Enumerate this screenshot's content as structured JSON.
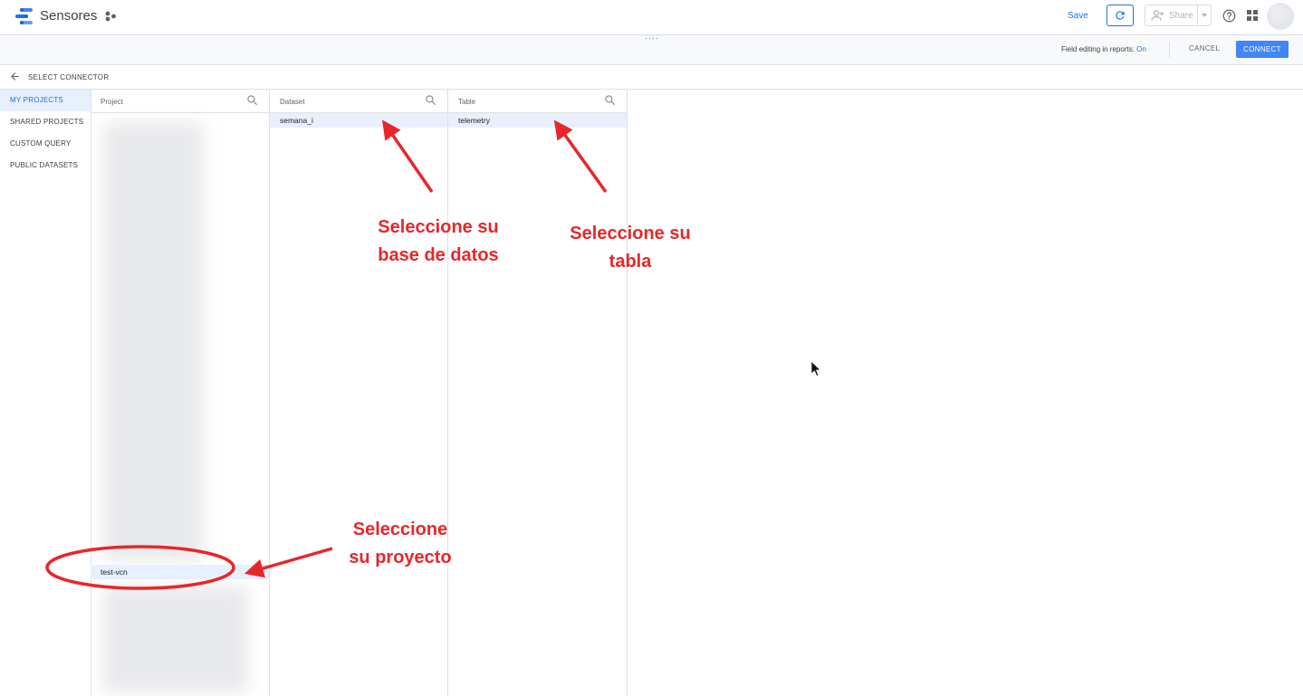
{
  "app": {
    "title": "Sensores"
  },
  "toolbar": {
    "save_label": "Save",
    "share_label": "Share"
  },
  "subbar": {
    "field_editing_label": "Field editing in reports:",
    "field_editing_value": "On",
    "cancel_label": "CANCEL",
    "connect_label": "CONNECT"
  },
  "breadcrumb": {
    "label": "SELECT CONNECTOR"
  },
  "sidebar": {
    "items": [
      {
        "label": "MY PROJECTS",
        "active": true
      },
      {
        "label": "SHARED PROJECTS"
      },
      {
        "label": "CUSTOM QUERY"
      },
      {
        "label": "PUBLIC DATASETS"
      }
    ]
  },
  "columns": {
    "project": {
      "header": "Project",
      "selected": "test-vcn"
    },
    "dataset": {
      "header": "Dataset",
      "selected": "semana_i"
    },
    "table": {
      "header": "Table",
      "selected": "telemetry"
    }
  },
  "annotations": {
    "dataset": [
      "Seleccione su",
      "base de datos"
    ],
    "table": [
      "Seleccione su",
      "tabla"
    ],
    "project": [
      "Seleccione",
      "su proyecto"
    ]
  },
  "colors": {
    "accent": "#1a73e8",
    "connect": "#4285f4",
    "annotation": "#e8262a",
    "selected_row": "#e8f0fe"
  }
}
